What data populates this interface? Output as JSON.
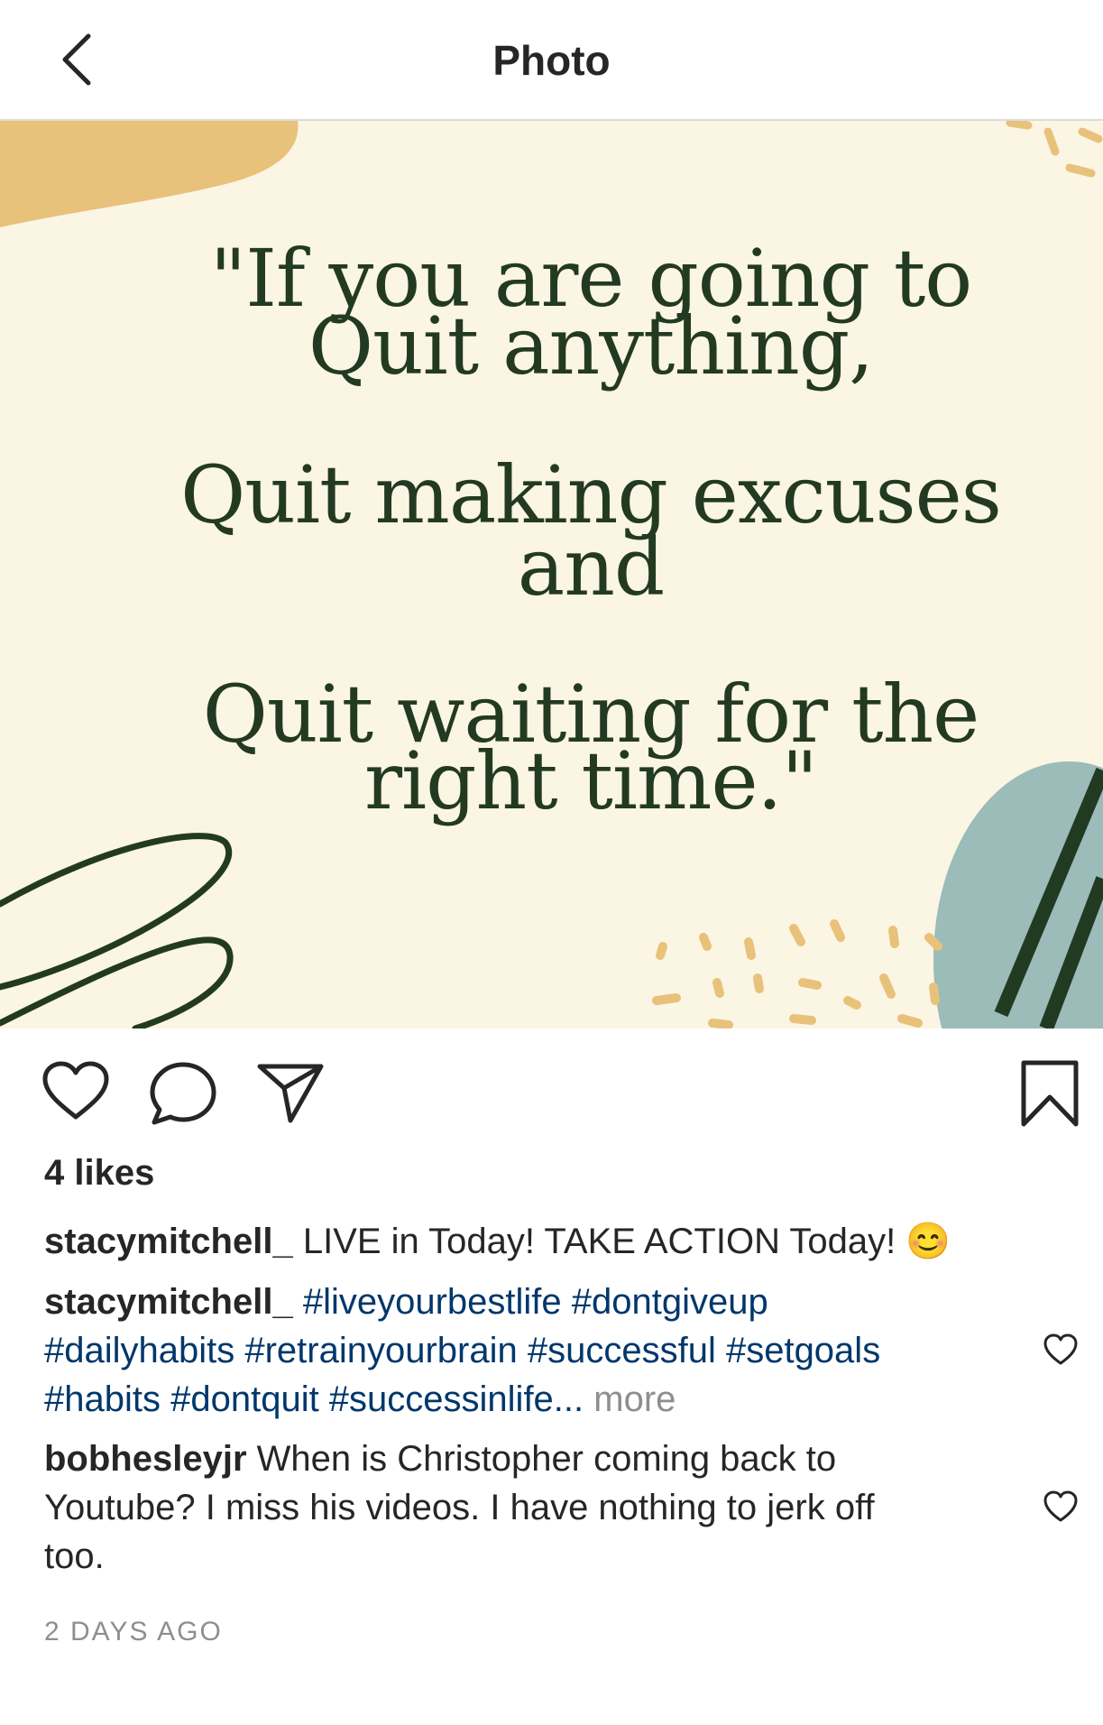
{
  "header": {
    "title": "Photo",
    "back_icon": "chevron-left-icon"
  },
  "post": {
    "image": {
      "quote_line_1": "\"If you are going to",
      "quote_line_2": "Quit anything,",
      "quote_line_3": "Quit making excuses",
      "quote_line_4": "and",
      "quote_line_5": "Quit waiting for the",
      "quote_line_6": "right time.\"",
      "colors": {
        "background": "#fbf5e4",
        "text": "#233a22",
        "accent_mustard": "#e8c27a",
        "accent_teal": "#9bbcb8"
      }
    },
    "actions": {
      "like_icon": "heart-icon",
      "comment_icon": "comment-icon",
      "share_icon": "paper-plane-icon",
      "save_icon": "bookmark-icon"
    },
    "likes": "4 likes",
    "caption": {
      "username": "stacymitchell_",
      "text": "LIVE in Today! TAKE ACTION Today!",
      "emoji": "😊"
    },
    "comments": [
      {
        "username": "stacymitchell_",
        "tags_line_1": "#liveyourbestlife #dontgiveup",
        "tags_line_2": "#dailyhabits #retrainyourbrain #successful #setgoals",
        "tags_line_3": "#habits #dontquit #successinlife...",
        "more": "more"
      },
      {
        "username": "bobhesleyjr",
        "text_line_1": "When is Christopher coming back to",
        "text_line_2": "Youtube? I miss his videos. I have nothing to jerk off",
        "text_line_3": "too."
      }
    ],
    "timestamp": "2 DAYS AGO",
    "link_color": "#00376b",
    "muted_color": "#8e8e8e"
  }
}
